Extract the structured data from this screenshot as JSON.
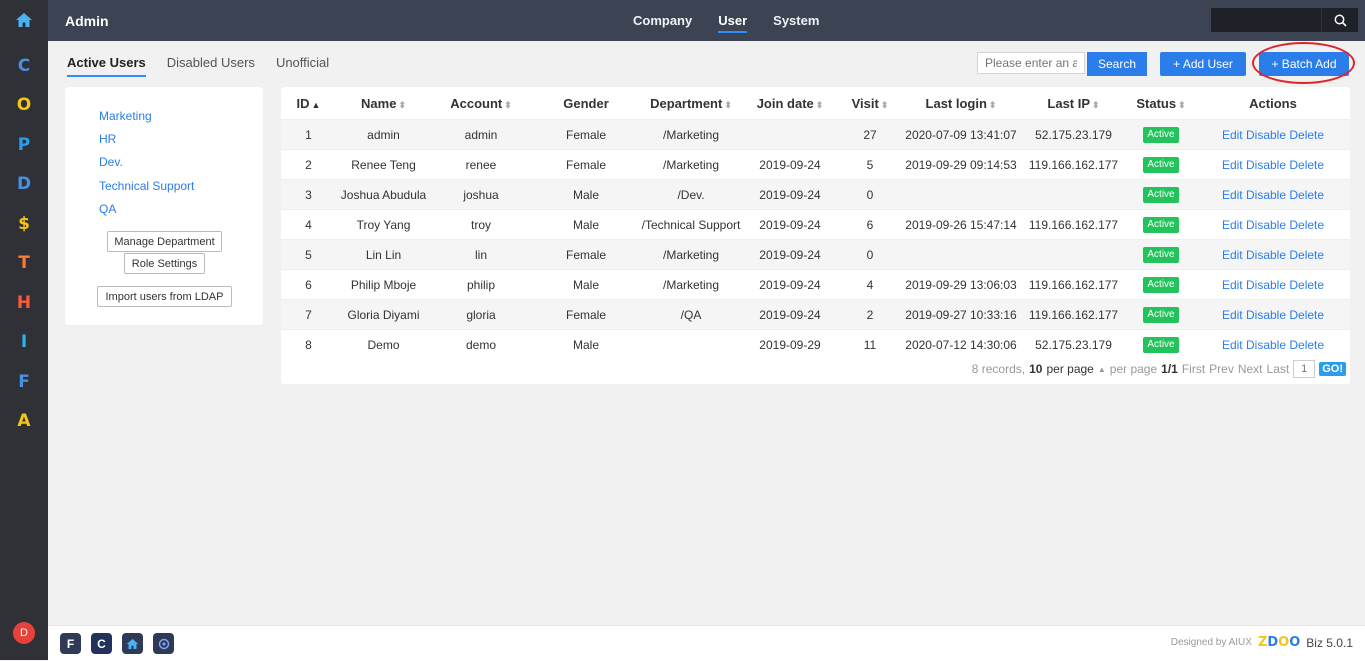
{
  "rail": {
    "letters": [
      {
        "char": "C",
        "color": "#4a90e2"
      },
      {
        "char": "O",
        "color": "#f5c518"
      },
      {
        "char": "P",
        "color": "#2b9dee"
      },
      {
        "char": "D",
        "color": "#4a90e2"
      },
      {
        "char": "$",
        "color": "#f5c518"
      },
      {
        "char": "T",
        "color": "#ff7a2f"
      },
      {
        "char": "H",
        "color": "#ff5a3c"
      },
      {
        "char": "I",
        "color": "#2bb3ee"
      },
      {
        "char": "F",
        "color": "#4a90e2"
      },
      {
        "char": "A",
        "color": "#f5c518"
      }
    ],
    "avatar": "D"
  },
  "topbar": {
    "title": "Admin",
    "nav": [
      "Company",
      "User",
      "System"
    ],
    "active_nav": "User"
  },
  "subtabs": [
    "Active Users",
    "Disabled Users",
    "Unofficial"
  ],
  "toolbar": {
    "search_placeholder": "Please enter an a",
    "search_label": "Search",
    "add_user_label": "+ Add User",
    "batch_add_label": "+ Batch Add"
  },
  "departments": [
    "Marketing",
    "HR",
    "Dev.",
    "Technical Support",
    "QA"
  ],
  "side_buttons": {
    "manage": "Manage Department",
    "roles": "Role Settings",
    "ldap": "Import users from LDAP"
  },
  "table": {
    "headers": [
      "ID",
      "Name",
      "Account",
      "Gender",
      "Department",
      "Join date",
      "Visit",
      "Last login",
      "Last IP",
      "Status",
      "Actions"
    ],
    "rows": [
      [
        "1",
        "admin",
        "admin",
        "Female",
        "/Marketing",
        "",
        "27",
        "2020-07-09 13:41:07",
        "52.175.23.179",
        "Active"
      ],
      [
        "2",
        "Renee Teng",
        "renee",
        "Female",
        "/Marketing",
        "2019-09-24",
        "5",
        "2019-09-29 09:14:53",
        "119.166.162.177",
        "Active"
      ],
      [
        "3",
        "Joshua Abudula",
        "joshua",
        "Male",
        "/Dev.",
        "2019-09-24",
        "0",
        "",
        "",
        "Active"
      ],
      [
        "4",
        "Troy Yang",
        "troy",
        "Male",
        "/Technical Support",
        "2019-09-24",
        "6",
        "2019-09-26 15:47:14",
        "119.166.162.177",
        "Active"
      ],
      [
        "5",
        "Lin Lin",
        "lin",
        "Female",
        "/Marketing",
        "2019-09-24",
        "0",
        "",
        "",
        "Active"
      ],
      [
        "6",
        "Philip Mboje",
        "philip",
        "Male",
        "/Marketing",
        "2019-09-24",
        "4",
        "2019-09-29 13:06:03",
        "119.166.162.177",
        "Active"
      ],
      [
        "7",
        "Gloria Diyami",
        "gloria",
        "Female",
        "/QA",
        "2019-09-24",
        "2",
        "2019-09-27 10:33:16",
        "119.166.162.177",
        "Active"
      ],
      [
        "8",
        "Demo",
        "demo",
        "Male",
        "",
        "2019-09-29",
        "11",
        "2020-07-12 14:30:06",
        "52.175.23.179",
        "Active"
      ]
    ],
    "actions": [
      "Edit",
      "Disable",
      "Delete"
    ]
  },
  "pager": {
    "records": "8 records,",
    "per_page": "10",
    "per_page_text": "per page",
    "per_page_dropdown": "per page",
    "pages": "1/1",
    "first": "First",
    "prev": "Prev",
    "next": "Next",
    "last": "Last",
    "page_input": "1",
    "go": "GO!"
  },
  "footer": {
    "dock": [
      "F",
      "C",
      "home",
      "circle"
    ],
    "designed_by": "Designed by AIUX",
    "brand": "ZDOO",
    "version": "Biz 5.0.1"
  },
  "colors": {
    "accent": "#2b7de9",
    "active_badge": "#21c35a",
    "highlight": "#e0252a"
  }
}
